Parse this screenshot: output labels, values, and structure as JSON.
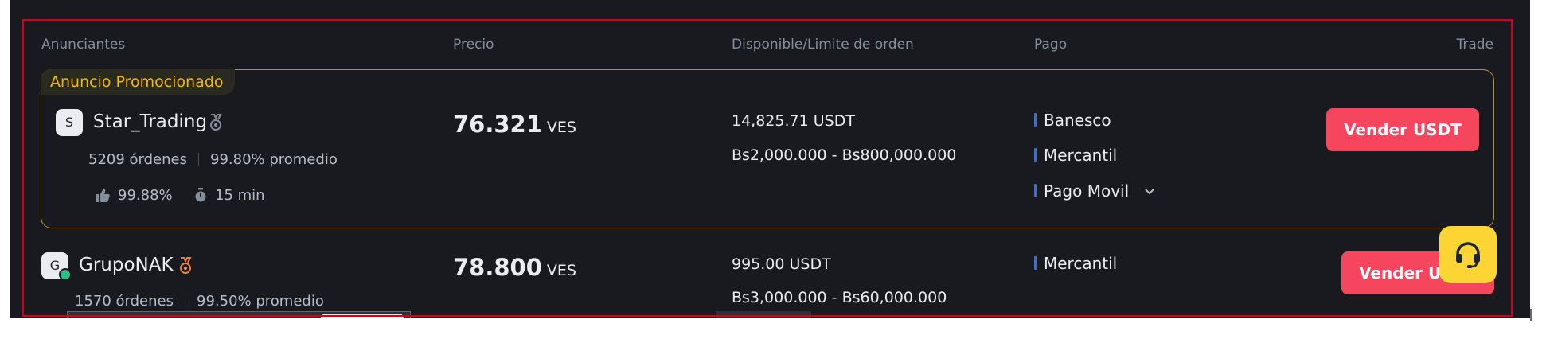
{
  "table": {
    "headers": {
      "advertisers": "Anunciantes",
      "price": "Precio",
      "available": "Disponible/Limite de orden",
      "payment": "Pago",
      "trade": "Trade"
    }
  },
  "promoted_label": "Anuncio Promocionado",
  "ads": [
    {
      "avatar_letter": "S",
      "name": "Star_Trading",
      "orders": "5209 órdenes",
      "completion": "99.80% promedio",
      "rating": "99.88%",
      "time": "15 min",
      "price": "76.321",
      "currency": "VES",
      "available": "14,825.71 USDT",
      "limit": "Bs2,000.000 - Bs800,000.000",
      "payments": [
        "Banesco",
        "Mercantil",
        "Pago Movil"
      ],
      "button": "Vender USDT"
    },
    {
      "avatar_letter": "G",
      "name": "GrupoNAK",
      "orders": "1570 órdenes",
      "completion": "99.50% promedio",
      "price": "78.800",
      "currency": "VES",
      "available": "995.00 USDT",
      "limit": "Bs3,000.000 - Bs60,000.000",
      "payments": [
        "Mercantil"
      ],
      "button": "Vender USDT"
    }
  ],
  "colors": {
    "background": "#181a20",
    "sell_button": "#f6465d",
    "promo_border": "#b5941d",
    "promo_text": "#f0b90b",
    "support_button": "#fcd535",
    "highlight_outline": "#d0021b"
  },
  "icons": {
    "medal": "medal-icon",
    "thumbs_up": "thumbs-up-icon",
    "timer": "stopwatch-icon",
    "chevron": "chevron-down-icon",
    "support": "headset-icon"
  }
}
